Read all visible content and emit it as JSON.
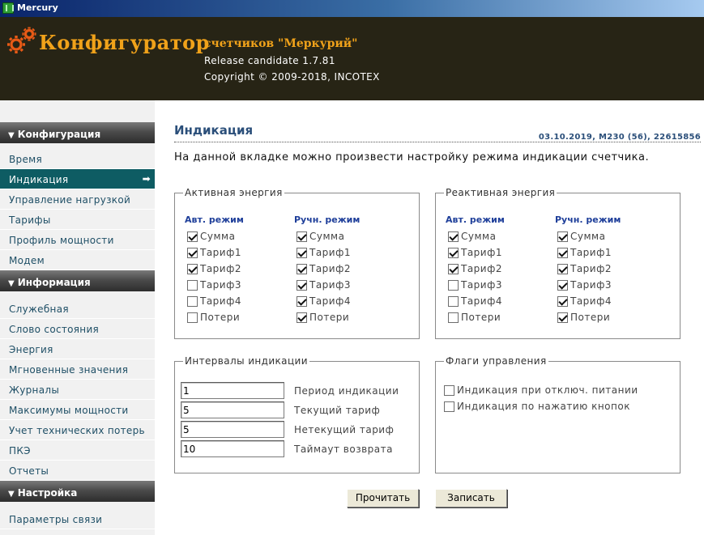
{
  "window": {
    "title": "Mercury"
  },
  "header": {
    "app_title": "Конфигуратор",
    "subtitle": "счетчиков \"Меркурий\"",
    "release": "Release candidate 1.7.81",
    "copyright": "Copyright © 2009-2018, INCOTEX"
  },
  "sidebar": {
    "sections": [
      {
        "title": "Конфигурация",
        "items": [
          "Время",
          "Индикация",
          "Управление нагрузкой",
          "Тарифы",
          "Профиль мощности",
          "Модем"
        ]
      },
      {
        "title": "Информация",
        "items": [
          "Служебная",
          "Слово состояния",
          "Энергия",
          "Мгновенные значения",
          "Журналы",
          "Максимумы мощности",
          "Учет технических потерь",
          "ПКЭ",
          "Отчеты"
        ]
      },
      {
        "title": "Настройка",
        "items": [
          "Параметры связи"
        ]
      }
    ],
    "active_item": "Индикация",
    "active_arrow": "➡"
  },
  "main": {
    "title": "Индикация",
    "meter_info": "03.10.2019, M230 (56), 22615856",
    "intro": "На данной вкладке можно произвести настройку режима индикации счетчика.",
    "active_energy": {
      "legend": "Активная энергия",
      "auto_head": "Авт. режим",
      "manual_head": "Ручн. режим",
      "auto": [
        {
          "label": "Сумма",
          "checked": true
        },
        {
          "label": "Тариф1",
          "checked": true
        },
        {
          "label": "Тариф2",
          "checked": true
        },
        {
          "label": "Тариф3",
          "checked": false
        },
        {
          "label": "Тариф4",
          "checked": false
        },
        {
          "label": "Потери",
          "checked": false
        }
      ],
      "manual": [
        {
          "label": "Сумма",
          "checked": true
        },
        {
          "label": "Тариф1",
          "checked": true
        },
        {
          "label": "Тариф2",
          "checked": true
        },
        {
          "label": "Тариф3",
          "checked": true
        },
        {
          "label": "Тариф4",
          "checked": true
        },
        {
          "label": "Потери",
          "checked": true
        }
      ]
    },
    "reactive_energy": {
      "legend": "Реактивная энергия",
      "auto_head": "Авт. режим",
      "manual_head": "Ручн. режим",
      "auto": [
        {
          "label": "Сумма",
          "checked": true
        },
        {
          "label": "Тариф1",
          "checked": true
        },
        {
          "label": "Тариф2",
          "checked": true
        },
        {
          "label": "Тариф3",
          "checked": false
        },
        {
          "label": "Тариф4",
          "checked": false
        },
        {
          "label": "Потери",
          "checked": false
        }
      ],
      "manual": [
        {
          "label": "Сумма",
          "checked": true
        },
        {
          "label": "Тариф1",
          "checked": true
        },
        {
          "label": "Тариф2",
          "checked": true
        },
        {
          "label": "Тариф3",
          "checked": true
        },
        {
          "label": "Тариф4",
          "checked": true
        },
        {
          "label": "Потери",
          "checked": true
        }
      ]
    },
    "intervals": {
      "legend": "Интервалы индикации",
      "rows": [
        {
          "value": "1",
          "label": "Период индикации"
        },
        {
          "value": "5",
          "label": "Текущий тариф"
        },
        {
          "value": "5",
          "label": "Нетекущий тариф"
        },
        {
          "value": "10",
          "label": "Таймаут возврата"
        }
      ]
    },
    "flags": {
      "legend": "Флаги управления",
      "items": [
        {
          "label": "Индикация при отключ. питании",
          "checked": false
        },
        {
          "label": "Индикация по нажатию кнопок",
          "checked": false
        }
      ]
    },
    "buttons": {
      "read": "Прочитать",
      "write": "Записать"
    }
  }
}
